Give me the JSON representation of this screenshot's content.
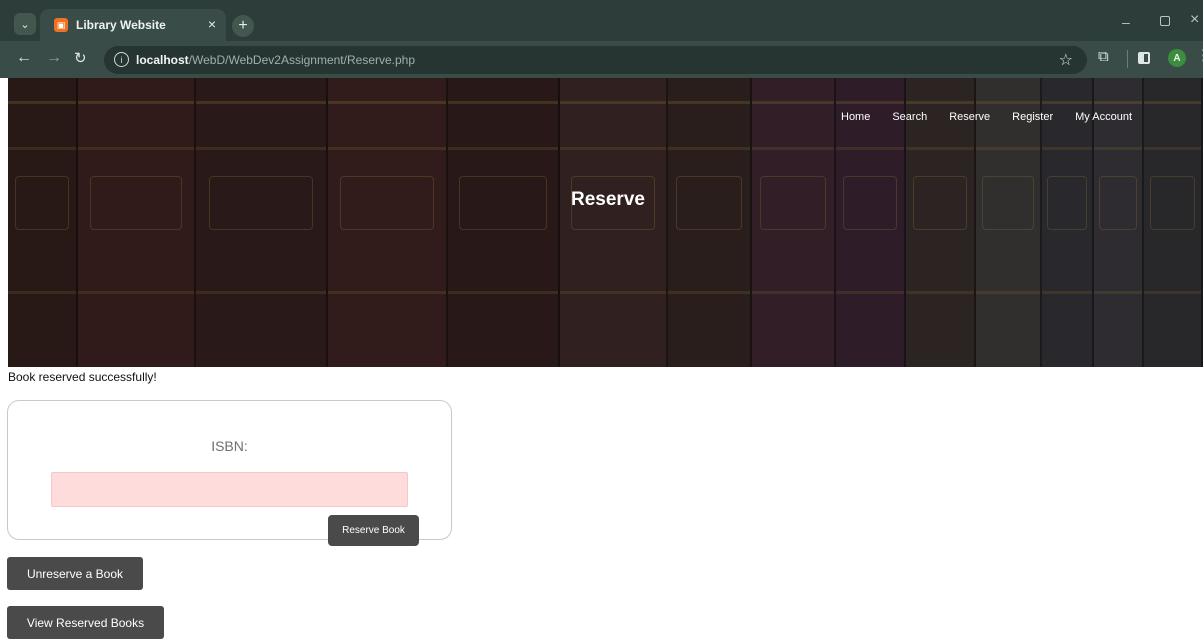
{
  "browser": {
    "tab_title": "Library Website",
    "url_host": "localhost",
    "url_path": "/WebD/WebDev2Assignment/Reserve.php",
    "profile_initial": "A"
  },
  "nav": {
    "items": [
      "Home",
      "Search",
      "Reserve",
      "Register",
      "My Account"
    ]
  },
  "hero": {
    "title": "Reserve"
  },
  "message": "Book reserved successfully!",
  "form": {
    "isbn_label": "ISBN:",
    "isbn_value": "",
    "submit_label": "Reserve Book"
  },
  "actions": {
    "unreserve_label": "Unreserve a Book",
    "view_label": "View Reserved Books"
  },
  "colors": {
    "button_bg": "#4a4a4a",
    "input_bg": "#ffdcdc",
    "chrome_bg": "#2d3e3a"
  }
}
